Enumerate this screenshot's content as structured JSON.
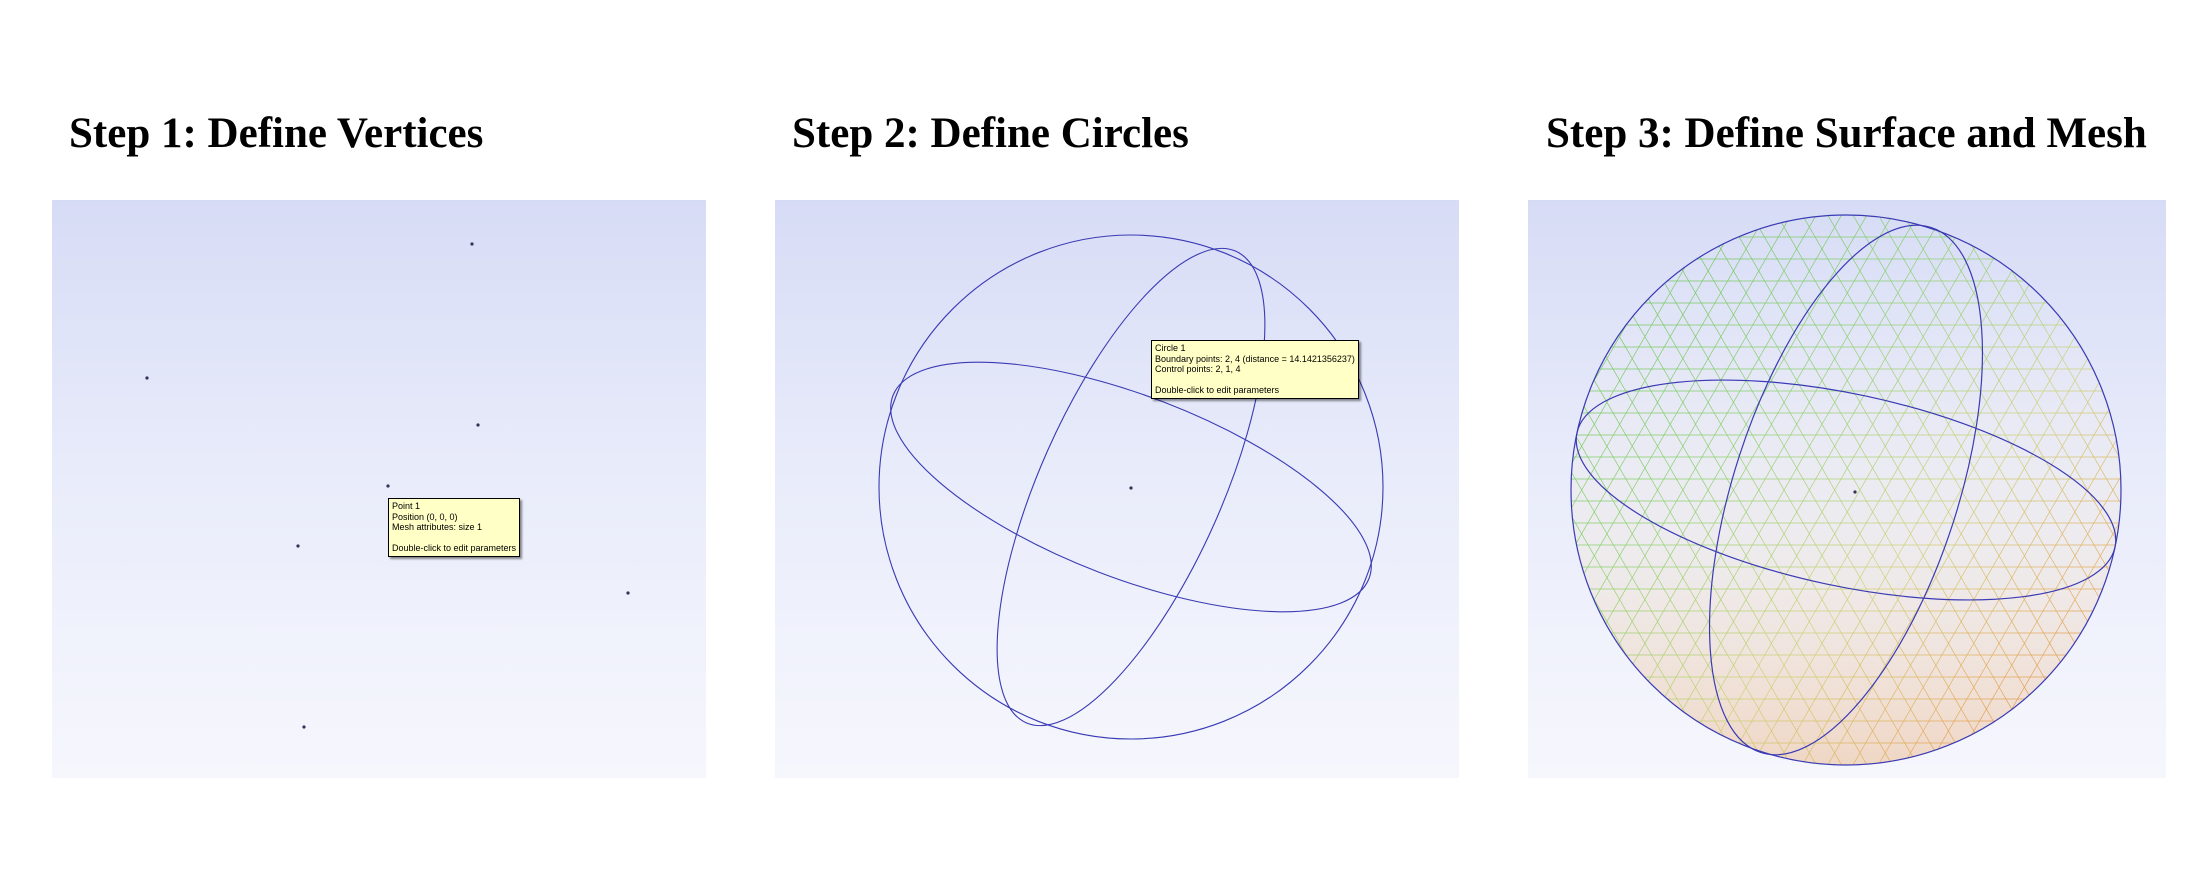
{
  "steps": [
    {
      "title": "Step 1: Define Vertices"
    },
    {
      "title": "Step 2: Define Circles"
    },
    {
      "title": "Step 3: Define Surface and Mesh"
    }
  ],
  "tooltip_point": {
    "line1": "Point 1",
    "line2": "Position (0, 0, 0)",
    "line3": "Mesh attributes: size 1",
    "line4": "",
    "line5": "Double-click to edit parameters"
  },
  "tooltip_circle": {
    "line1": "Circle 1",
    "line2": "Boundary points: 2, 4 (distance = 14.1421356237)",
    "line3": "Control points: 2, 1, 4",
    "line4": "",
    "line5": "Double-click to edit parameters"
  },
  "colors": {
    "curve": "#3a3ab4",
    "mesh_green": "#58c03a",
    "mesh_yellow": "#e6c21a",
    "mesh_orange": "#dc7a2a",
    "vertex": "#333355"
  }
}
